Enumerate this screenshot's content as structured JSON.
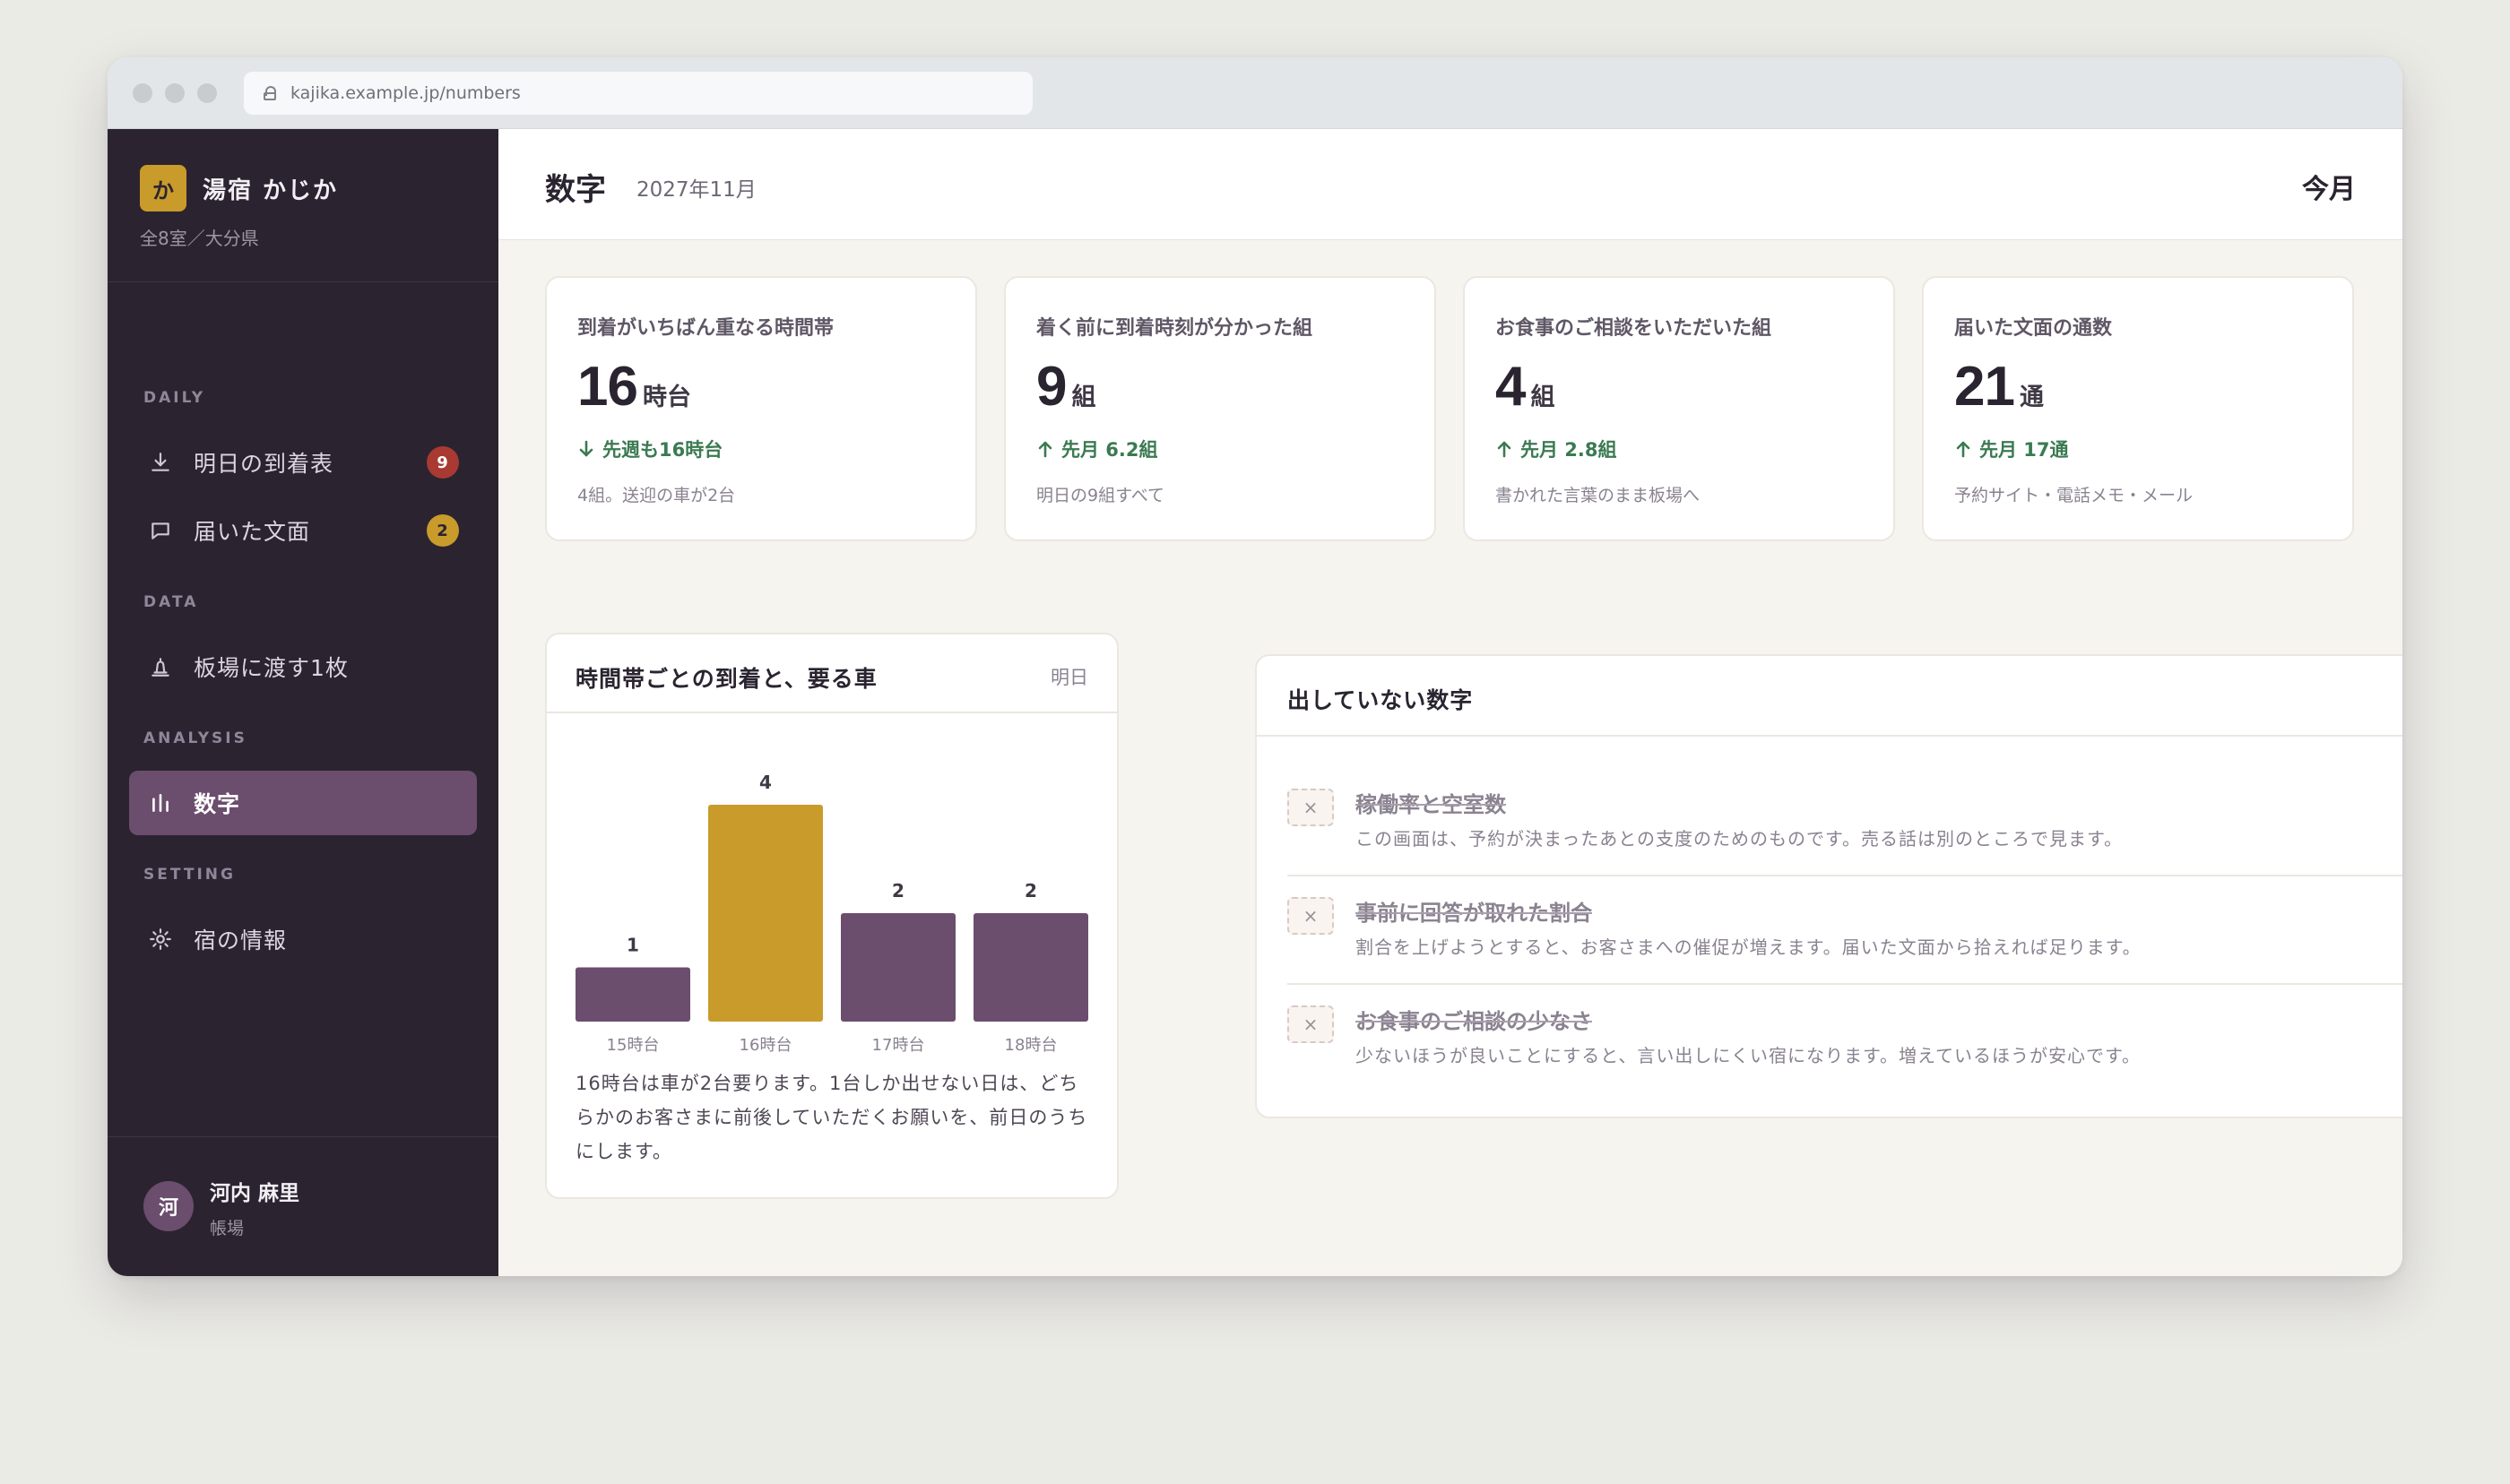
{
  "browser": {
    "url": "kajika.example.jp/numbers"
  },
  "sidebar": {
    "brand_mark": "か",
    "brand_name": "湯宿 かじか",
    "brand_sub": "全8室／大分県",
    "sections": {
      "daily": "DAILY",
      "data": "DATA",
      "analysis": "ANALYSIS",
      "setting": "SETTING"
    },
    "items": [
      {
        "label": "明日の到着表",
        "icon": "download-icon",
        "badge": "9"
      },
      {
        "label": "届いた文面",
        "icon": "chat-icon",
        "badge": "2"
      },
      {
        "label": "板場に渡す1枚",
        "icon": "bell-icon"
      },
      {
        "label": "数字",
        "icon": "bar-chart-icon",
        "active": true
      },
      {
        "label": "宿の情報",
        "icon": "gear-icon"
      }
    ],
    "user": {
      "initial": "河",
      "name": "河内 麻里",
      "role": "帳場"
    }
  },
  "header": {
    "title": "数字",
    "date": "2027年11月",
    "period": "今月"
  },
  "kpis": [
    {
      "label": "到着がいちばん重なる時間帯",
      "value": "16",
      "unit": "時台",
      "trend": "先週も16時台",
      "trend_dir": "down",
      "note": "4組。送迎の車が2台"
    },
    {
      "label": "着く前に到着時刻が分かった組",
      "value": "9",
      "unit": "組",
      "trend": "先月 6.2組",
      "trend_dir": "up",
      "note": "明日の9組すべて"
    },
    {
      "label": "お食事のご相談をいただいた組",
      "value": "4",
      "unit": "組",
      "trend": "先月 2.8組",
      "trend_dir": "up",
      "note": "書かれた言葉のまま板場へ"
    },
    {
      "label": "届いた文面の通数",
      "value": "21",
      "unit": "通",
      "trend": "先月 17通",
      "trend_dir": "up",
      "note": "予約サイト・電話メモ・メール"
    }
  ],
  "chart_panel": {
    "title": "時間帯ごとの到着と、要る車",
    "tag": "明日",
    "note": "16時台は車が2台要ります。1台しか出せない日は、どちらかのお客さまに前後していただくお願いを、前日のうちにします。"
  },
  "chart_data": {
    "type": "bar",
    "categories": [
      "15時台",
      "16時台",
      "17時台",
      "18時台"
    ],
    "values": [
      1,
      4,
      2,
      2
    ],
    "highlight_index": 1,
    "ylim": [
      0,
      4
    ],
    "colors": {
      "bar": "#6b4d6d",
      "highlight": "#c99b2b"
    }
  },
  "hidden_panel": {
    "title": "出していない数字",
    "items": [
      {
        "title": "稼働率と空室数",
        "desc": "この画面は、予約が決まったあとの支度のためのものです。売る話は別のところで見ます。"
      },
      {
        "title": "事前に回答が取れた割合",
        "desc": "割合を上げようとすると、お客さまへの催促が増えます。届いた文面から拾えれば足ります。"
      },
      {
        "title": "お食事のご相談の少なさ",
        "desc": "少ないほうが良いことにすると、言い出しにくい宿になります。増えているほうが安心です。"
      }
    ],
    "x_mark": "×"
  }
}
